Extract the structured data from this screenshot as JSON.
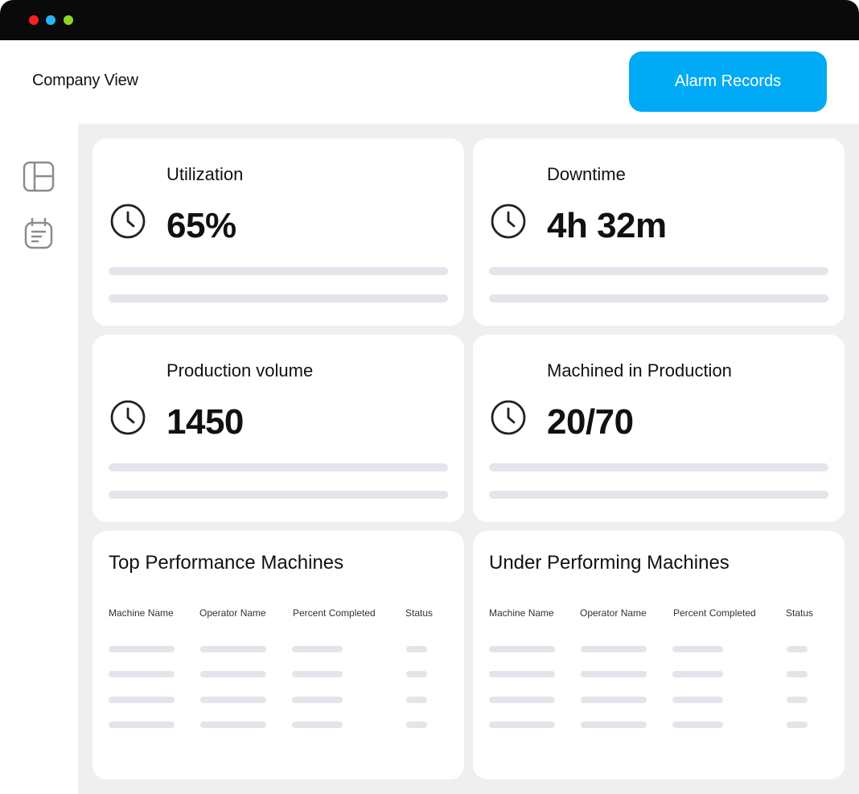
{
  "window": {
    "controls": [
      "close",
      "minimize",
      "maximize"
    ]
  },
  "colors": {
    "titlebar": "#0a0a0a",
    "close_dot": "#ff1f1f",
    "minimize_dot": "#2ab2ff",
    "maximize_dot": "#8bd62a",
    "accent": "#00aaf4",
    "background": "#efefef",
    "placeholder": "#e4e4ea"
  },
  "header": {
    "title": "Company View",
    "alarm_button_label": "Alarm Records"
  },
  "sidebar": {
    "items": [
      {
        "icon": "layout-dashboard-icon"
      },
      {
        "icon": "calendar-notes-icon"
      }
    ]
  },
  "stats": [
    {
      "label": "Utilization",
      "value": "65%",
      "icon": "clock-icon"
    },
    {
      "label": "Downtime",
      "value": "4h 32m",
      "icon": "clock-icon"
    },
    {
      "label": "Production volume",
      "value": "1450",
      "icon": "clock-icon"
    },
    {
      "label": "Machined in Production",
      "value": "20/70",
      "icon": "clock-icon"
    }
  ],
  "tables": [
    {
      "title": "Top Performance Machines",
      "columns": [
        "Machine Name",
        "Operator Name",
        "Percent Completed",
        "Status"
      ]
    },
    {
      "title": "Under Performing Machines",
      "columns": [
        "Machine Name",
        "Operator Name",
        "Percent Completed",
        "Status"
      ]
    }
  ]
}
